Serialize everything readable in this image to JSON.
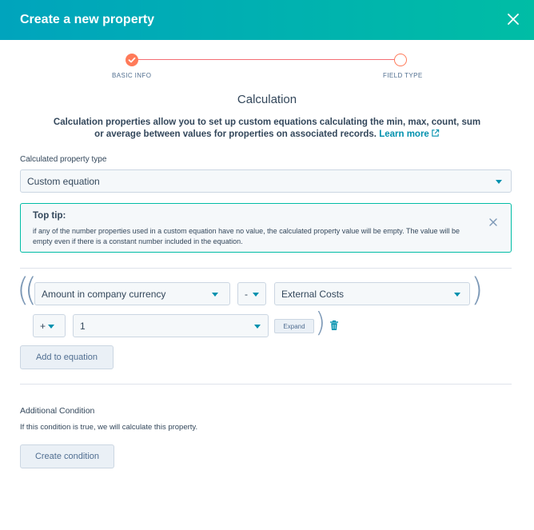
{
  "header": {
    "title": "Create a new property",
    "close_icon": "close-icon"
  },
  "stepper": {
    "steps": [
      {
        "label": "BASIC INFO",
        "state": "complete"
      },
      {
        "label": "FIELD TYPE",
        "state": "current"
      }
    ],
    "accent_color": "#ff7a59"
  },
  "main": {
    "title": "Calculation",
    "description": "Calculation properties allow you to set up custom equations calculating the min, max, count, sum or average between values for properties on associated records.",
    "learn_more": "Learn more"
  },
  "calc_type": {
    "label": "Calculated property type",
    "value": "Custom equation"
  },
  "tip": {
    "title": "Top tip:",
    "text": "if any of the number properties used in a custom equation have no value, the calculated property value will be empty. The value will be empty even if there is a constant number included in the equation."
  },
  "equation": {
    "open_parens": "((",
    "close_paren_outer": ")",
    "close_paren_inner": ")",
    "row1": {
      "operand1": "Amount in company currency",
      "operator": "-",
      "operand2": "External Costs"
    },
    "row2": {
      "operator": "+",
      "operand": "1",
      "expand_label": "Expand"
    },
    "add_button": "Add to equation"
  },
  "condition": {
    "title": "Additional Condition",
    "text": "If this condition is true, we will calculate this property.",
    "button": "Create condition"
  },
  "colors": {
    "header_start": "#00a4bd",
    "header_end": "#00bda5",
    "link": "#0091ae",
    "text": "#33475b"
  }
}
